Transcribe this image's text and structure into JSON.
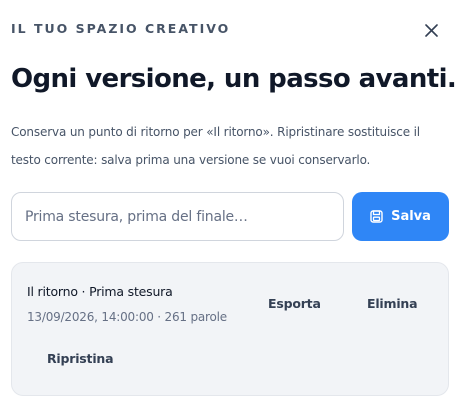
{
  "header": {
    "eyebrow": "IL TUO SPAZIO CREATIVO",
    "close_icon": "close-icon"
  },
  "title": "Ogni versione, un passo avanti.",
  "description": "Conserva un punto di ritorno per «Il ritorno». Ripristinare sostituisce il testo corrente: salva prima una versione se vuoi conservarlo.",
  "form": {
    "placeholder": "Prima stesura, prima del finale…",
    "value": "",
    "save_label": "Salva",
    "save_icon": "save-icon"
  },
  "versions": [
    {
      "name": "Il ritorno · Prima stesura",
      "meta": "13/09/2026, 14:00:00 · 261 parole",
      "export_label": "Esporta",
      "delete_label": "Elimina",
      "restore_label": "Ripristina"
    }
  ],
  "colors": {
    "accent": "#2f86f6",
    "card_bg": "#f2f4f7"
  }
}
